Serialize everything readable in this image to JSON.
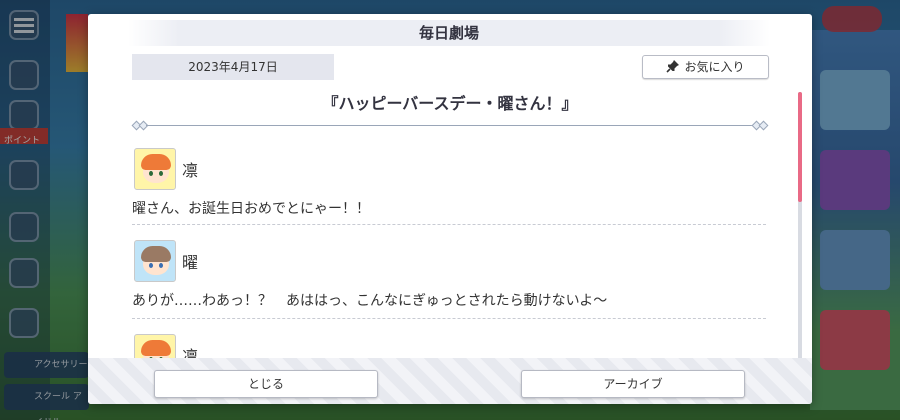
{
  "dialog": {
    "title": "毎日劇場",
    "date": "2023年4月17日",
    "favorite_label": "お気に入り",
    "favorite_icon": "pin-icon",
    "story_title": "『ハッピーバースデー・曜さん！』",
    "entries": [
      {
        "speaker": "凛",
        "avatar": "rin-avatar",
        "text": "曜さん、お誕生日おめでとにゃー！！"
      },
      {
        "speaker": "曜",
        "avatar": "you-avatar",
        "text": "ありが……わあっ！？　あははっ、こんなにぎゅっとされたら動けないよ～"
      },
      {
        "speaker": "凛",
        "avatar": "rin-avatar",
        "text": ""
      }
    ],
    "close_label": "とじる",
    "archive_label": "アーカイブ"
  },
  "colors": {
    "scroll_thumb": "#e96a86",
    "date_bg": "#e4e6ee"
  },
  "background": {
    "left_tag": "ポイント",
    "bottom_buttons": [
      "アクセサリー",
      "スクール アイドル"
    ]
  }
}
